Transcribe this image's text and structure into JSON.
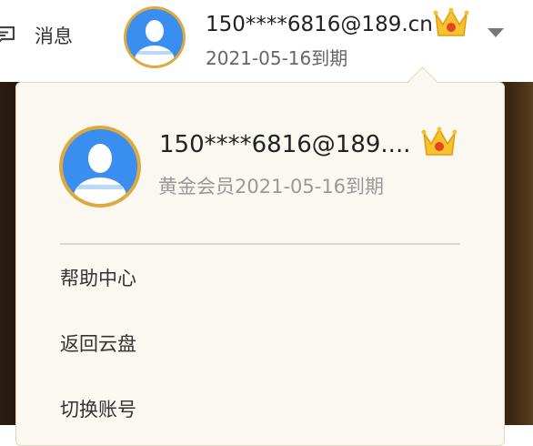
{
  "header": {
    "messages_label": "消息",
    "account_email": "150****6816@189.cn",
    "expire_text": "2021-05-16到期"
  },
  "panel": {
    "account_email": "150****6816@189....",
    "membership_text": "黄金会员2021-05-16到期",
    "menu": [
      {
        "label": "帮助中心"
      },
      {
        "label": "返回云盘"
      },
      {
        "label": "切换账号"
      }
    ]
  },
  "icons": {
    "messages": "message-icon",
    "avatar": "user-avatar-icon",
    "vip": "crown-icon",
    "dropdown": "chevron-down-icon"
  },
  "colors": {
    "avatar_ring": "#e0a93c",
    "avatar_fill": "#3a8ef0",
    "crown_gold": "#f6c22e",
    "crown_gem": "#e8431f",
    "panel_bg": "#fbf8f2"
  }
}
